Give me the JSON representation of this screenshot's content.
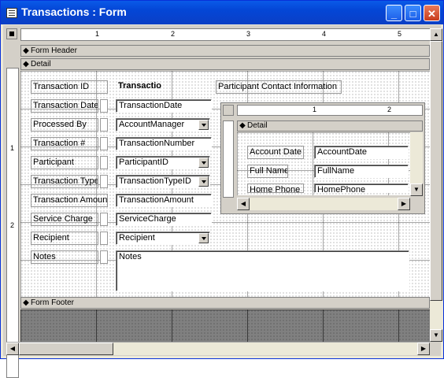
{
  "window": {
    "title": "Transactions : Form"
  },
  "ruler": {
    "top_marks": [
      "1",
      "2",
      "3",
      "4",
      "5"
    ],
    "left_marks": [
      "1",
      "2"
    ]
  },
  "sections": {
    "header": "Form Header",
    "detail": "Detail",
    "footer": "Form Footer"
  },
  "fields": [
    {
      "label": "Transaction ID",
      "value": "Transactio",
      "type": "text",
      "bold": true
    },
    {
      "label": "Transaction Date",
      "value": "TransactionDate",
      "type": "text"
    },
    {
      "label": "Processed By",
      "value": "AccountManager",
      "type": "combo"
    },
    {
      "label": "Transaction #",
      "value": "TransactionNumber",
      "type": "text"
    },
    {
      "label": "Participant",
      "value": "ParticipantID",
      "type": "combo"
    },
    {
      "label": "Transaction Type",
      "value": "TransactionTypeID",
      "type": "combo"
    },
    {
      "label": "Transaction Amount",
      "value": "TransactionAmount",
      "type": "text"
    },
    {
      "label": "Service Charge",
      "value": "ServiceCharge",
      "type": "text"
    },
    {
      "label": "Recipient",
      "value": "Recipient",
      "type": "combo"
    },
    {
      "label": "Notes",
      "value": "Notes",
      "type": "memo"
    }
  ],
  "subform": {
    "title": "Participant Contact Information",
    "section": "Detail",
    "ruler_marks": [
      "1",
      "2"
    ],
    "fields": [
      {
        "label": "Account Date",
        "value": "AccountDate"
      },
      {
        "label": "Full Name",
        "value": "FullName"
      },
      {
        "label": "Home Phone",
        "value": "HomePhone"
      }
    ]
  }
}
